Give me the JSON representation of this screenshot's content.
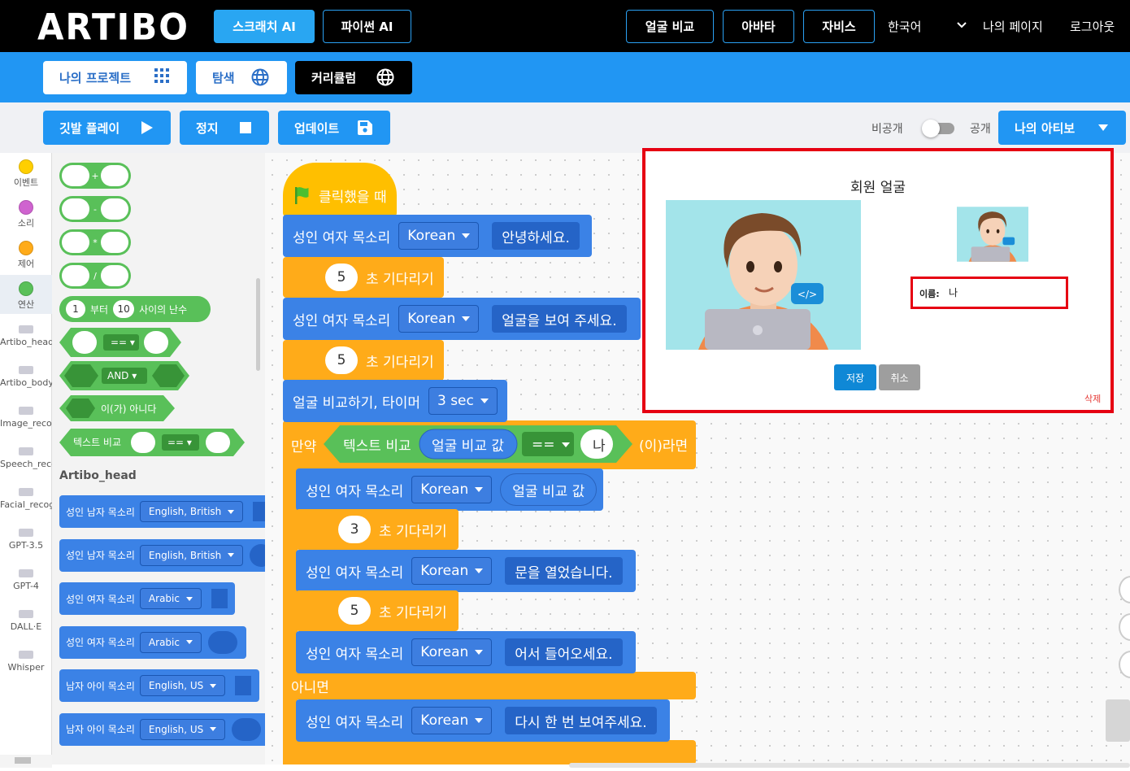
{
  "topbar": {
    "logo": "ARTIBO",
    "scratch_ai": "스크래치 AI",
    "python_ai": "파이썬 AI",
    "face_compare": "얼굴 비교",
    "avatar": "아바타",
    "jarvis": "자비스",
    "language": "한국어",
    "my_page": "나의 페이지",
    "logout": "로그아웃"
  },
  "subbar": {
    "my_projects": "나의 프로젝트",
    "explore": "탐색",
    "curriculum": "커리큘럼"
  },
  "controls": {
    "flag_play": "깃발 플레이",
    "stop": "정지",
    "update": "업데이트",
    "private": "비공개",
    "public": "공개",
    "my_artibo": "나의 아티보"
  },
  "categories": [
    {
      "label": "이벤트",
      "color": "#ffcf00"
    },
    {
      "label": "소리",
      "color": "#cf63cf"
    },
    {
      "label": "제어",
      "color": "#ffab19"
    },
    {
      "label": "연산",
      "color": "#59c059"
    },
    {
      "label": "Artibo_head"
    },
    {
      "label": "Artibo_body"
    },
    {
      "label": "Image_recog"
    },
    {
      "label": "Speech_reco"
    },
    {
      "label": "Facial_recog"
    },
    {
      "label": "GPT-3.5"
    },
    {
      "label": "GPT-4"
    },
    {
      "label": "DALL·E"
    },
    {
      "label": "Whisper"
    }
  ],
  "palette": {
    "ops": [
      "+",
      "-",
      "*",
      "/"
    ],
    "random_from": "1",
    "random_word1": "부터",
    "random_to": "10",
    "random_word2": "사이의 난수",
    "eq": "==",
    "and": "AND",
    "not": "이(가) 아니다",
    "text_compare": "텍스트 비교",
    "section": "Artibo_head",
    "voices": [
      {
        "label": "성인 남자 목소리",
        "lang": "English, British"
      },
      {
        "label": "성인 남자 목소리",
        "lang": "English, British"
      },
      {
        "label": "성인 여자 목소리",
        "lang": "Arabic"
      },
      {
        "label": "성인 여자 목소리",
        "lang": "Arabic"
      },
      {
        "label": "남자 아이 목소리",
        "lang": "English, US"
      },
      {
        "label": "남자 아이 목소리",
        "lang": "English, US"
      }
    ]
  },
  "script": {
    "hat": "클릭했을 때",
    "voice": "성인 여자 목소리",
    "lang": "Korean",
    "say1": "안녕하세요.",
    "wait1": "5",
    "wait_word": "초 기다리기",
    "say2": "얼굴을 보여 주세요.",
    "wait2": "5",
    "compare": "얼굴 비교하기, 타이머",
    "timer": "3 sec",
    "if": "만약",
    "text_compare": "텍스트 비교",
    "compare_value": "얼굴 비교 값",
    "eq": "==",
    "name": "나",
    "then": "(이)라면",
    "wait3": "3",
    "say3": "문을 열었습니다.",
    "wait4": "5",
    "say4": "어서 들어오세요.",
    "else": "아니면",
    "say5": "다시 한 번 보여주세요."
  },
  "modal": {
    "title": "회원 얼굴",
    "name_label": "이름:",
    "name_value": "나",
    "save": "저장",
    "cancel": "취소",
    "delete": "삭제"
  }
}
